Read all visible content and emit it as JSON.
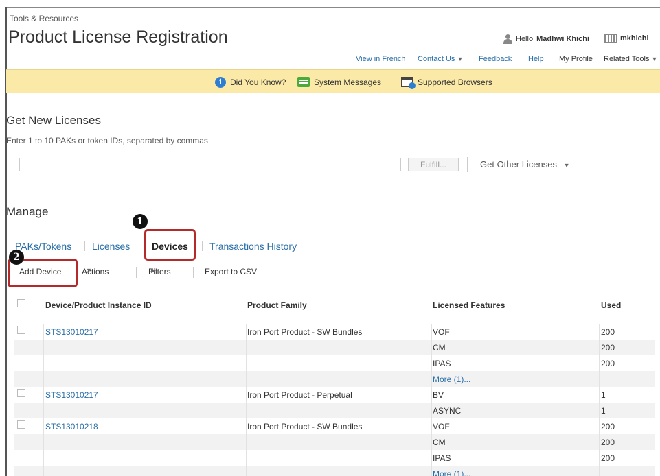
{
  "breadcrumb": "Tools & Resources",
  "title": "Product License Registration",
  "user": {
    "greeting_prefix": "Hello",
    "name": "Madhwi Khichi",
    "username": "mkhichi"
  },
  "topnav": {
    "view_french": "View in French",
    "contact_us": "Contact Us",
    "feedback": "Feedback",
    "help": "Help",
    "my_profile": "My Profile",
    "related_tools": "Related Tools"
  },
  "banner": {
    "did_you_know": "Did You Know?",
    "system_messages": "System Messages",
    "supported_browsers": "Supported Browsers"
  },
  "get_licenses": {
    "heading": "Get New Licenses",
    "helper": "Enter 1 to 10 PAKs or token IDs, separated by commas",
    "input_value": "",
    "fulfill": "Fulfill...",
    "other": "Get Other Licenses"
  },
  "manage": {
    "heading": "Manage",
    "tabs": [
      "PAKs/Tokens",
      "Licenses",
      "Devices",
      "Transactions History"
    ],
    "active_tab": "Devices",
    "actions": {
      "add_device": "Add Device",
      "actions": "Actions",
      "filters": "Filters",
      "export": "Export to CSV"
    }
  },
  "annotations": {
    "step1": "1",
    "step2": "2"
  },
  "table": {
    "headers": [
      "Device/Product Instance ID",
      "Product Family",
      "Licensed Features",
      "Used"
    ],
    "rows": [
      {
        "id": "STS13010217",
        "family": "Iron Port Product - SW Bundles",
        "feature": "VOF",
        "used": "200",
        "checkbox": true
      },
      {
        "id": "",
        "family": "",
        "feature": "CM",
        "used": "200",
        "checkbox": false
      },
      {
        "id": "",
        "family": "",
        "feature": "IPAS",
        "used": "200",
        "checkbox": false
      },
      {
        "id": "",
        "family": "",
        "feature": "More (1)...",
        "used": "",
        "checkbox": false,
        "feature_link": true
      },
      {
        "id": "STS13010217",
        "family": "Iron Port Product - Perpetual",
        "feature": "BV",
        "used": "1",
        "checkbox": true
      },
      {
        "id": "",
        "family": "",
        "feature": "ASYNC",
        "used": "1",
        "checkbox": false
      },
      {
        "id": "STS13010218",
        "family": "Iron Port Product - SW Bundles",
        "feature": "VOF",
        "used": "200",
        "checkbox": true
      },
      {
        "id": "",
        "family": "",
        "feature": "CM",
        "used": "200",
        "checkbox": false
      },
      {
        "id": "",
        "family": "",
        "feature": "IPAS",
        "used": "200",
        "checkbox": false
      },
      {
        "id": "",
        "family": "",
        "feature": "More (1)...",
        "used": "",
        "checkbox": false,
        "feature_link": true
      }
    ]
  },
  "colors": {
    "link": "#2a6fa8",
    "banner_bg": "#fbe9a8",
    "highlight": "#b42a2a"
  }
}
